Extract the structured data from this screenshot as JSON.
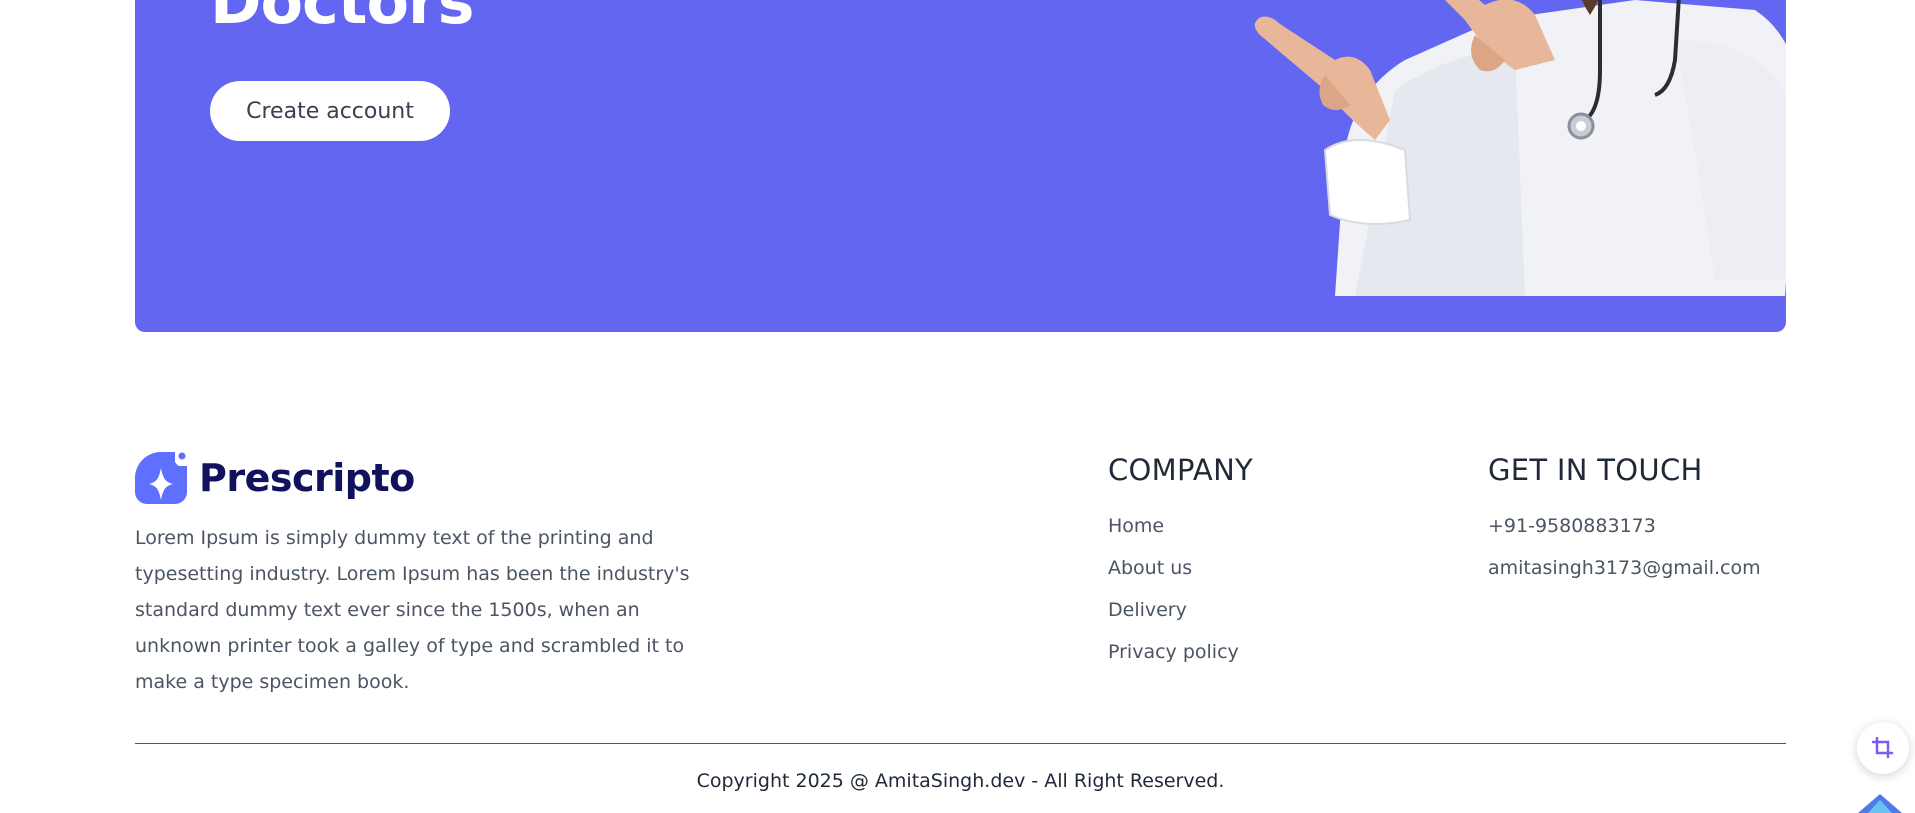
{
  "banner": {
    "title": "Doctors",
    "create_account_label": "Create account",
    "background_color": "#6366f1"
  },
  "footer": {
    "logo": {
      "icon": "prescripto-logo-icon",
      "name": "Prescripto"
    },
    "description": "Lorem Ipsum is simply dummy text of the printing and typesetting industry. Lorem Ipsum has been the industry's standard dummy text ever since the 1500s, when an unknown printer took a galley of type and scrambled it to make a type specimen book.",
    "company": {
      "heading": "COMPANY",
      "links": [
        "Home",
        "About us",
        "Delivery",
        "Privacy policy"
      ]
    },
    "contact": {
      "heading": "GET IN TOUCH",
      "phone": "+91-9580883173",
      "email": "amitasingh3173@gmail.com"
    },
    "copyright": "Copyright 2025 @ AmitaSingh.dev - All Right Reserved."
  },
  "widgets": {
    "crop_icon": "crop-icon",
    "gem_icon": "gem-icon"
  }
}
